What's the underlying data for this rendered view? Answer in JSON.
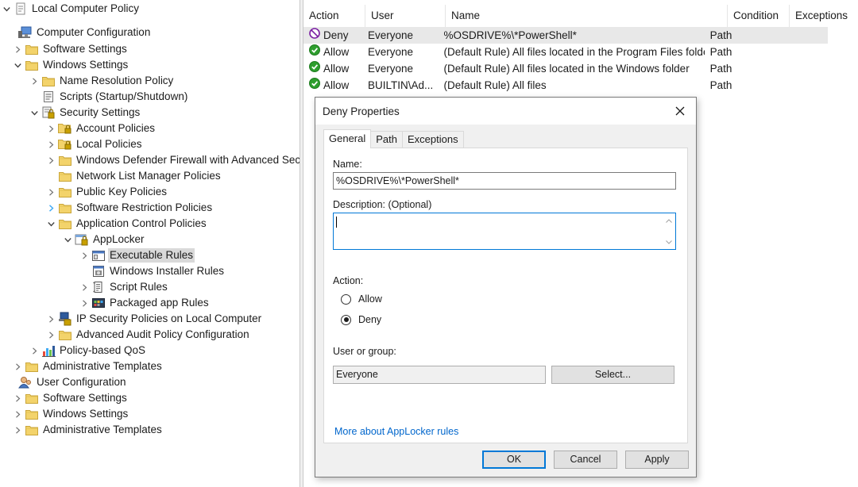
{
  "tree": {
    "items": [
      {
        "label": "Local Computer Policy",
        "icon": "policy-root-icon",
        "expand": "down"
      },
      {
        "label": "Computer Configuration",
        "icon": "computer-icon",
        "expand": "none"
      },
      {
        "label": "Software Settings",
        "icon": "folder-icon",
        "expand": "right"
      },
      {
        "label": "Windows Settings",
        "icon": "folder-icon",
        "expand": "down"
      },
      {
        "label": "Name Resolution Policy",
        "icon": "folder-icon",
        "expand": "right"
      },
      {
        "label": "Scripts (Startup/Shutdown)",
        "icon": "script-icon",
        "expand": "none"
      },
      {
        "label": "Security Settings",
        "icon": "security-settings-icon",
        "expand": "down"
      },
      {
        "label": "Account Policies",
        "icon": "folder-lock-icon",
        "expand": "right"
      },
      {
        "label": "Local Policies",
        "icon": "folder-lock-icon",
        "expand": "right"
      },
      {
        "label": "Windows Defender Firewall with Advanced Security",
        "icon": "folder-icon",
        "expand": "right"
      },
      {
        "label": "Network List Manager Policies",
        "icon": "folder-icon",
        "expand": "none"
      },
      {
        "label": "Public Key Policies",
        "icon": "folder-icon",
        "expand": "right"
      },
      {
        "label": "Software Restriction Policies",
        "icon": "folder-icon",
        "expand": "right-blue"
      },
      {
        "label": "Application Control Policies",
        "icon": "folder-icon",
        "expand": "down"
      },
      {
        "label": "AppLocker",
        "icon": "applocker-icon",
        "expand": "down"
      },
      {
        "label": "Executable Rules",
        "icon": "executable-rules-icon",
        "expand": "right",
        "selected": true
      },
      {
        "label": "Windows Installer Rules",
        "icon": "installer-rules-icon",
        "expand": "none"
      },
      {
        "label": "Script Rules",
        "icon": "script-rules-icon",
        "expand": "right"
      },
      {
        "label": "Packaged app Rules",
        "icon": "packaged-app-icon",
        "expand": "right"
      },
      {
        "label": "IP Security Policies on Local Computer",
        "icon": "ip-security-icon",
        "expand": "right"
      },
      {
        "label": "Advanced Audit Policy Configuration",
        "icon": "folder-icon",
        "expand": "right"
      },
      {
        "label": "Policy-based QoS",
        "icon": "qos-chart-icon",
        "expand": "right"
      },
      {
        "label": "Administrative Templates",
        "icon": "folder-icon",
        "expand": "right"
      },
      {
        "label": "User Configuration",
        "icon": "user-icon",
        "expand": "none"
      },
      {
        "label": "Software Settings",
        "icon": "folder-icon",
        "expand": "right"
      },
      {
        "label": "Windows Settings",
        "icon": "folder-icon",
        "expand": "right"
      },
      {
        "label": "Administrative Templates",
        "icon": "folder-icon",
        "expand": "right"
      }
    ]
  },
  "list": {
    "columns": [
      "Action",
      "User",
      "Name",
      "Condition",
      "Exceptions"
    ],
    "rows": [
      {
        "action": "Deny",
        "status_icon": "deny-icon",
        "user": "Everyone",
        "name": "%OSDRIVE%\\*PowerShell*",
        "condition": "Path",
        "exceptions": ""
      },
      {
        "action": "Allow",
        "status_icon": "allow-icon",
        "user": "Everyone",
        "name": "(Default Rule) All files located in the Program Files folder",
        "condition": "Path",
        "exceptions": ""
      },
      {
        "action": "Allow",
        "status_icon": "allow-icon",
        "user": "Everyone",
        "name": "(Default Rule) All files located in the Windows folder",
        "condition": "Path",
        "exceptions": ""
      },
      {
        "action": "Allow",
        "status_icon": "allow-icon",
        "user": "BUILTIN\\Ad...",
        "name": "(Default Rule) All files",
        "condition": "Path",
        "exceptions": ""
      }
    ]
  },
  "dialog": {
    "title": "Deny Properties",
    "tabs": [
      "General",
      "Path",
      "Exceptions"
    ],
    "name_label": "Name:",
    "name_value": "%OSDRIVE%\\*PowerShell*",
    "description_label": "Description: (Optional)",
    "description_value": "",
    "action_label": "Action:",
    "allow_label": "Allow",
    "deny_label": "Deny",
    "selected_action": "Deny",
    "user_group_label": "User or group:",
    "user_group_value": "Everyone",
    "select_button": "Select...",
    "more_link": "More about AppLocker rules",
    "ok_button": "OK",
    "cancel_button": "Cancel",
    "apply_button": "Apply"
  },
  "colors": {
    "folder": "#f3d36b",
    "allow": "#2e9e2e",
    "deny": "#7a1fa2",
    "link": "#0066cc",
    "selection": "#d9d9d9"
  }
}
